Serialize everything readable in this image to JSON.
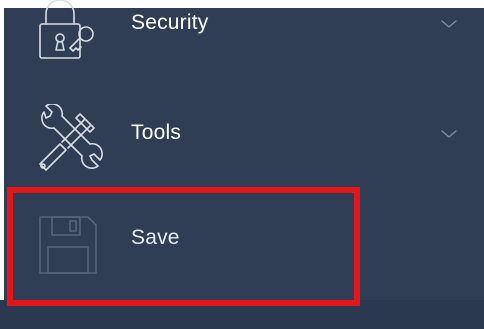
{
  "sidebar": {
    "items": [
      {
        "label": "Security",
        "icon": "lock-key-icon",
        "has_submenu": true
      },
      {
        "label": "Tools",
        "icon": "tools-icon",
        "has_submenu": true
      },
      {
        "label": "Save",
        "icon": "floppy-disk-icon",
        "has_submenu": false
      }
    ]
  },
  "highlight": {
    "target": "Save",
    "color": "#e4161c"
  },
  "colors": {
    "sidebar_background": "#2f3e54",
    "text": "#ffffff",
    "icon_stroke": "#d8dde6",
    "chevron": "#7f8aa0"
  }
}
